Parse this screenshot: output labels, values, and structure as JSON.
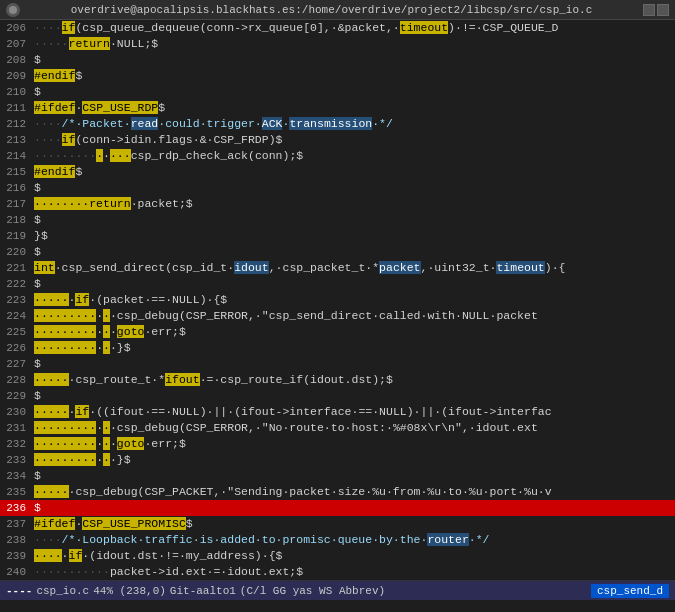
{
  "title": "overdrive@apocalipsis.blackhats.es:/home/overdrive/project2/libcsp/src/csp_io.c",
  "window_controls": [
    "□",
    "□"
  ],
  "lines": [
    {
      "num": "206",
      "content": "····if(csp_queue_dequeue(conn->rx_queue[0],·&packet,·timeout)·!=·CSP_QUEUE_D"
    },
    {
      "num": "207",
      "content": "·····return·NULL;$"
    },
    {
      "num": "208",
      "content": "$"
    },
    {
      "num": "209",
      "content": "#endif$"
    },
    {
      "num": "210",
      "content": "$"
    },
    {
      "num": "211",
      "content": "#ifdef·CSP_USE_RDP$"
    },
    {
      "num": "212",
      "content": "····/*·Packet·read·could·trigger·ACK·transmission·*/"
    },
    {
      "num": "213",
      "content": "····if(conn->idin.flags·&·CSP_FRDP)$"
    },
    {
      "num": "214",
      "content": "·········csp_rdp_check_ack(conn);$"
    },
    {
      "num": "215",
      "content": "#endif$"
    },
    {
      "num": "216",
      "content": "$"
    },
    {
      "num": "217",
      "content": "········return·packet;$"
    },
    {
      "num": "218",
      "content": "$"
    },
    {
      "num": "219",
      "content": "}$"
    },
    {
      "num": "220",
      "content": "$"
    },
    {
      "num": "221",
      "content": "int·csp_send_direct(csp_id_t·idout,·csp_packet_t·*packet,·uint32_t·timeout)·{"
    },
    {
      "num": "222",
      "content": "$"
    },
    {
      "num": "223",
      "content": "·····if·(packet·==·NULL)·{$"
    },
    {
      "num": "224",
      "content": "·········csp_debug(CSP_ERROR,·\"csp_send_direct·called·with·NULL·packet"
    },
    {
      "num": "225",
      "content": "·········goto·err;$"
    },
    {
      "num": "226",
      "content": "·········}$"
    },
    {
      "num": "227",
      "content": "$"
    },
    {
      "num": "228",
      "content": "·····csp_route_t·*ifout·=·csp_route_if(idout.dst);$"
    },
    {
      "num": "229",
      "content": "$"
    },
    {
      "num": "230",
      "content": "·····if·((ifout·==·NULL)·||·(ifout->interface·==·NULL)·||·(ifout->interfac"
    },
    {
      "num": "231",
      "content": "·········csp_debug(CSP_ERROR,·\"No·route·to·host:·%#08x\\r\\n\",·idout.ext"
    },
    {
      "num": "232",
      "content": "·········goto·err;$"
    },
    {
      "num": "233",
      "content": "·········}$"
    },
    {
      "num": "234",
      "content": "$"
    },
    {
      "num": "235",
      "content": "·····csp_debug(CSP_PACKET,·\"Sending·packet·size·%u·from·%u·to·%u·port·%u·v"
    },
    {
      "num": "236",
      "content": "$"
    },
    {
      "num": "237",
      "content": "#ifdef·CSP_USE_PROMISC$"
    },
    {
      "num": "238",
      "content": "····/*·Loopback·traffic·is·added·to·promisc·queue·by·the·router·*/"
    },
    {
      "num": "239",
      "content": "····if·(idout.dst·!=·my_address)·{$"
    },
    {
      "num": "240",
      "content": "···········packet->id.ext·=·idout.ext;$"
    }
  ],
  "status": {
    "mode": "----",
    "filename": "csp_io.c",
    "position": "44% (238,0)",
    "git": "Git-aalto1",
    "info": "(C/l GG yas WS Abbrev)",
    "right": "csp_send_d"
  }
}
